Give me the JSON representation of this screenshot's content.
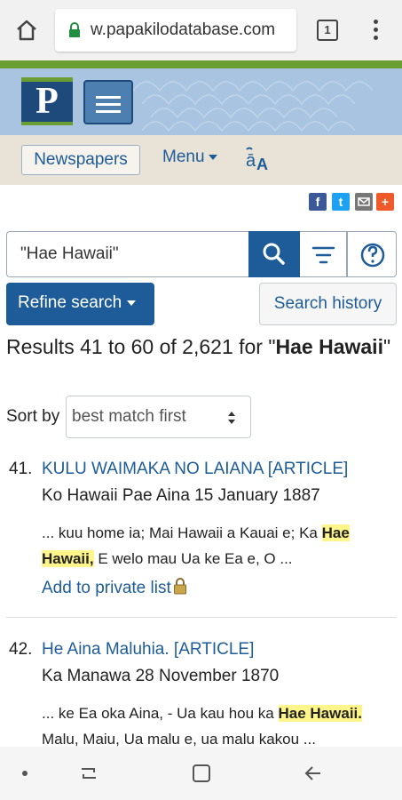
{
  "browser": {
    "url": "w.papakilodatabase.com",
    "tab_count": "1",
    "icons": [
      "home-icon",
      "lock-icon",
      "tabs-icon",
      "kebab-menu-icon"
    ]
  },
  "header": {
    "logo_letter": "P",
    "icons": [
      "hamburger-icon"
    ]
  },
  "nav": {
    "newspapers_label": "Newspapers",
    "menu_label": "Menu",
    "icons": [
      "language-icon",
      "caret-down-icon"
    ]
  },
  "share": {
    "icons": [
      "facebook-icon",
      "twitter-icon",
      "email-icon",
      "plus-icon"
    ],
    "fb_glyph": "f",
    "tw_glyph": "t",
    "plus_glyph": "+"
  },
  "search": {
    "query": "\"Hae Hawaii\"",
    "icons": [
      "search-icon",
      "filter-icon",
      "help-icon"
    ]
  },
  "refine_label": "Refine search",
  "history_label": "Search history",
  "results_heading": {
    "prefix": "Results 41 to 60 of 2,621 for \"",
    "term": "Hae Hawaii",
    "suffix": "\""
  },
  "sort": {
    "label": "Sort by",
    "selected": "best match first"
  },
  "results": [
    {
      "num": "41.",
      "title": "KULU WAIMAKA NO LAIANA [ARTICLE]",
      "source": "Ko Hawaii Pae Aina 15 January 1887",
      "snippet_pre": "... kuu home ia; Mai Hawaii a Kauai e; Ka ",
      "snippet_hl": "Hae Hawaii,",
      "snippet_post": " E welo mau Ua ke Ea e, O ...",
      "add_label": "Add to private list"
    },
    {
      "num": "42.",
      "title": "He Aina Maluhia. [ARTICLE]",
      "source": "Ka Manawa 28 November 1870",
      "snippet_pre": "... ke Ea oka Aina, - Ua kau hou ka ",
      "snippet_hl": "Hae Hawaii.",
      "snippet_post": " Malu, Maiu, Ua malu e, ua malu kakou ..."
    }
  ],
  "android_nav": {
    "icons": [
      "dot-icon",
      "recent-apps-icon",
      "home-square-icon",
      "back-icon"
    ]
  },
  "colors": {
    "primary": "#1d5c99",
    "green": "#6a9e32",
    "header_bg": "#a9c4e0",
    "nav_bg": "#e9e3d7",
    "highlight": "#fff58a"
  }
}
